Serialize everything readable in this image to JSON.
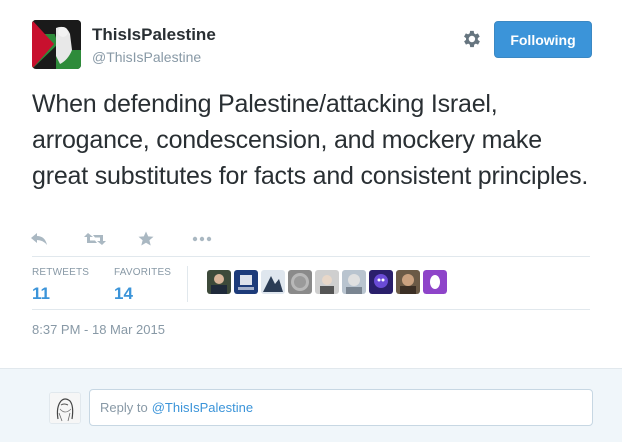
{
  "tweet": {
    "display_name": "ThisIsPalestine",
    "screen_name": "@ThisIsPalestine",
    "follow_label": "Following",
    "text": "When defending Palestine/attacking Israel, arrogance, condescension, and mockery make great substitutes for facts and consistent principles.",
    "timestamp": "8:37 PM - 18 Mar 2015"
  },
  "actions": [
    {
      "name": "reply-icon"
    },
    {
      "name": "retweet-icon"
    },
    {
      "name": "favorite-icon"
    },
    {
      "name": "more-icon"
    }
  ],
  "stats": {
    "retweets_label": "RETWEETS",
    "retweets_value": "11",
    "favorites_label": "FAVORITES",
    "favorites_value": "14"
  },
  "reply": {
    "prefix": "Reply to",
    "handle": "@ThisIsPalestine"
  },
  "colors": {
    "accent": "#3b94d9",
    "text": "#292f33",
    "muted": "#8899a6",
    "reply_bg": "#f0f6fa"
  }
}
